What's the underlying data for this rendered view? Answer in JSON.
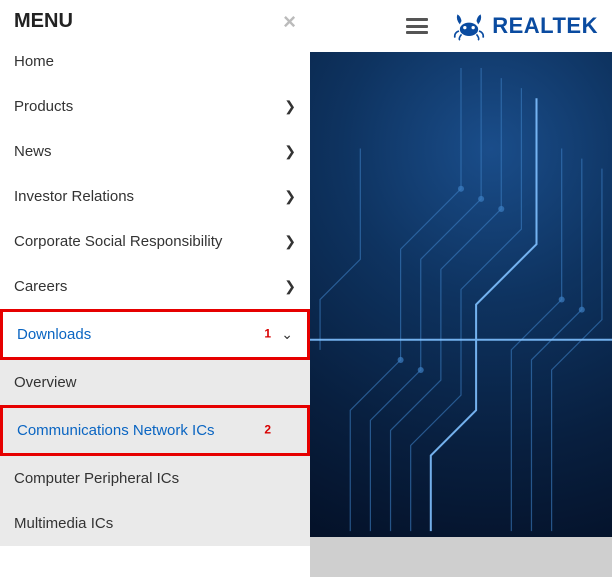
{
  "header": {
    "brand_name": "REALTEK"
  },
  "menu": {
    "title": "MENU",
    "close_glyph": "×",
    "items": [
      {
        "label": "Home",
        "has_children": false
      },
      {
        "label": "Products",
        "has_children": true
      },
      {
        "label": "News",
        "has_children": true
      },
      {
        "label": "Investor Relations",
        "has_children": true
      },
      {
        "label": "Corporate Social Responsibility",
        "has_children": true
      },
      {
        "label": "Careers",
        "has_children": true
      }
    ],
    "downloads": {
      "label": "Downloads",
      "annotation": "1",
      "subitems": [
        {
          "label": "Overview"
        },
        {
          "label": "Communications Network ICs",
          "annotation": "2",
          "highlight": true
        },
        {
          "label": "Computer Peripheral ICs"
        },
        {
          "label": "Multimedia ICs"
        }
      ]
    }
  }
}
